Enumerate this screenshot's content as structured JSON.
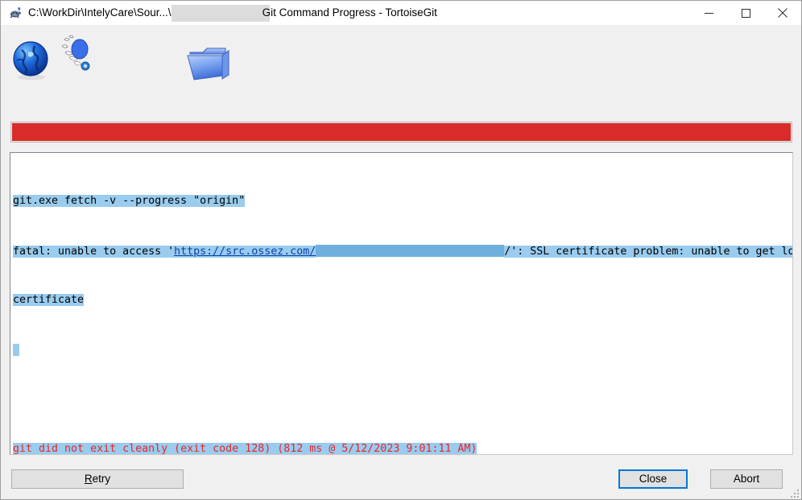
{
  "window": {
    "app_icon": "tortoisegit-turtle-icon",
    "title_prefix": "C:\\WorkDir\\IntelyCare\\Sour...\\",
    "title_redacted": true,
    "title_suffix": "Git Command Progress - TortoiseGit",
    "controls": {
      "minimize": "minimize-icon",
      "maximize": "maximize-icon",
      "close": "close-icon"
    }
  },
  "icons": {
    "globe": "globe-icon",
    "transfer_animation": "transfer-animation-icon",
    "folder": "folder-icon"
  },
  "progress": {
    "state": "error",
    "percent": 100,
    "color": "#d92b29"
  },
  "log": {
    "lines": [
      {
        "id": "command",
        "text": "git.exe fetch -v --progress \"origin\"",
        "selected": true,
        "color": "#000000"
      },
      {
        "id": "fatal-error",
        "prefix": "fatal: unable to access '",
        "link": "https://src.ossez.com/",
        "redacted": true,
        "suffix": "/': SSL certificate problem: unable to get local issuer",
        "selected": true,
        "color": "#000000"
      },
      {
        "id": "fatal-error-wrap",
        "text": "certificate",
        "selected": true,
        "color": "#000000"
      },
      {
        "id": "blank-selected",
        "text": "",
        "selected": true,
        "color": "#000000"
      },
      {
        "id": "blank",
        "text": "",
        "selected": false,
        "color": "#000000"
      },
      {
        "id": "exit-status",
        "text": "git did not exit cleanly (exit code 128) (812 ms @ 5/12/2023 9:01:11 AM)",
        "selected": true,
        "color": "#e8262a"
      }
    ]
  },
  "buttons": {
    "retry": {
      "accel": "R",
      "rest": "etry"
    },
    "close": "Close",
    "abort": "Abort"
  }
}
